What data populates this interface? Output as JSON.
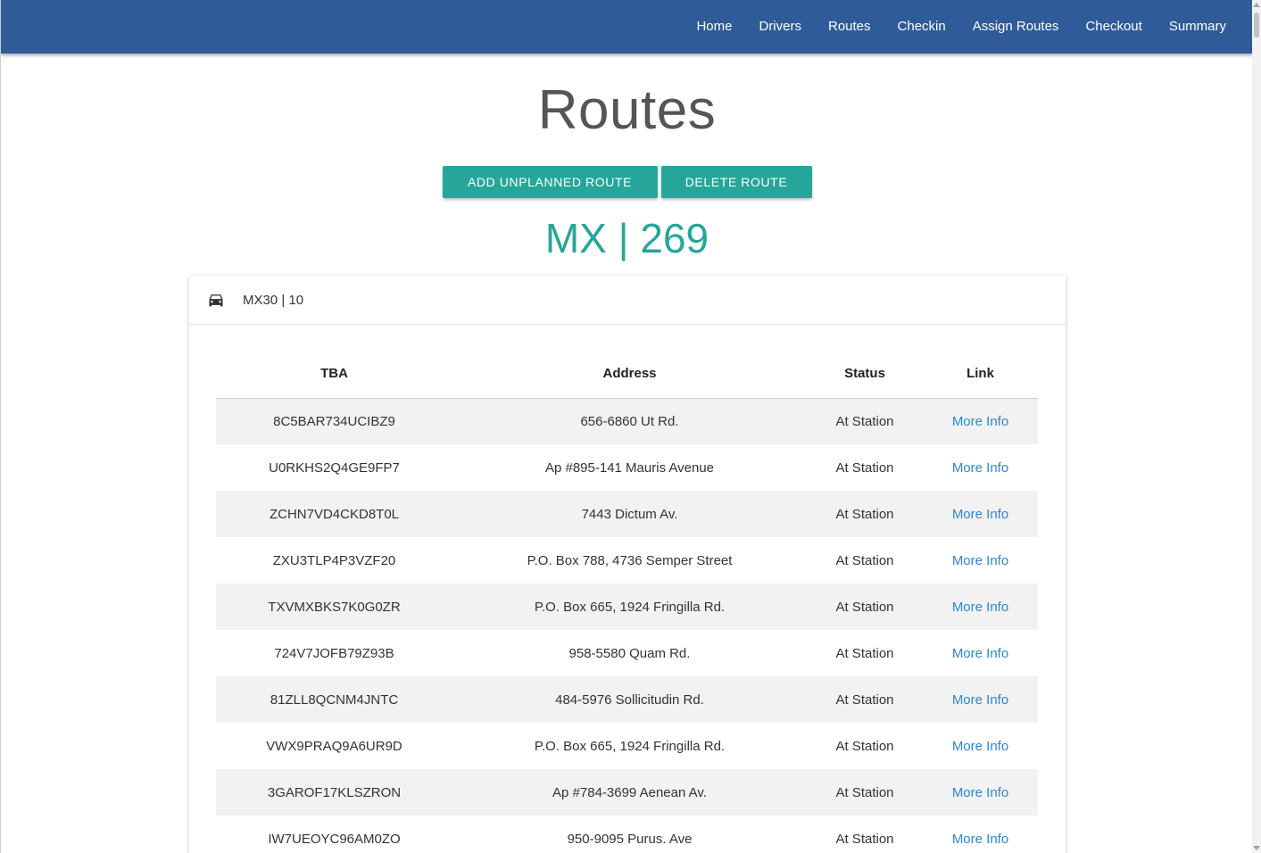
{
  "nav": {
    "items": [
      {
        "label": "Home"
      },
      {
        "label": "Drivers"
      },
      {
        "label": "Routes"
      },
      {
        "label": "Checkin"
      },
      {
        "label": "Assign Routes"
      },
      {
        "label": "Checkout"
      },
      {
        "label": "Summary"
      }
    ]
  },
  "page": {
    "title": "Routes",
    "add_button": "ADD UNPLANNED ROUTE",
    "delete_button": "DELETE ROUTE",
    "route_heading": "MX | 269"
  },
  "card": {
    "header": "MX30 | 10",
    "icon": "car-icon"
  },
  "table": {
    "headers": [
      "TBA",
      "Address",
      "Status",
      "Link"
    ],
    "rows": [
      {
        "tba": "8C5BAR734UCIBZ9",
        "address": "656-6860 Ut Rd.",
        "status": "At Station",
        "link": "More Info"
      },
      {
        "tba": "U0RKHS2Q4GE9FP7",
        "address": "Ap #895-141 Mauris Avenue",
        "status": "At Station",
        "link": "More Info"
      },
      {
        "tba": "ZCHN7VD4CKD8T0L",
        "address": "7443 Dictum Av.",
        "status": "At Station",
        "link": "More Info"
      },
      {
        "tba": "ZXU3TLP4P3VZF20",
        "address": "P.O. Box 788, 4736 Semper Street",
        "status": "At Station",
        "link": "More Info"
      },
      {
        "tba": "TXVMXBKS7K0G0ZR",
        "address": "P.O. Box 665, 1924 Fringilla Rd.",
        "status": "At Station",
        "link": "More Info"
      },
      {
        "tba": "724V7JOFB79Z93B",
        "address": "958-5580 Quam Rd.",
        "status": "At Station",
        "link": "More Info"
      },
      {
        "tba": "81ZLL8QCNM4JNTC",
        "address": "484-5976 Sollicitudin Rd.",
        "status": "At Station",
        "link": "More Info"
      },
      {
        "tba": "VWX9PRAQ9A6UR9D",
        "address": "P.O. Box 665, 1924 Fringilla Rd.",
        "status": "At Station",
        "link": "More Info"
      },
      {
        "tba": "3GAROF17KLSZRON",
        "address": "Ap #784-3699 Aenean Av.",
        "status": "At Station",
        "link": "More Info"
      },
      {
        "tba": "IW7UEOYC96AM0ZO",
        "address": "950-9095 Purus. Ave",
        "status": "At Station",
        "link": "More Info"
      }
    ]
  },
  "colors": {
    "navbar": "#2f5b98",
    "accent": "#26a69a",
    "link": "#2f86d0",
    "stripe": "#f2f2f2"
  }
}
